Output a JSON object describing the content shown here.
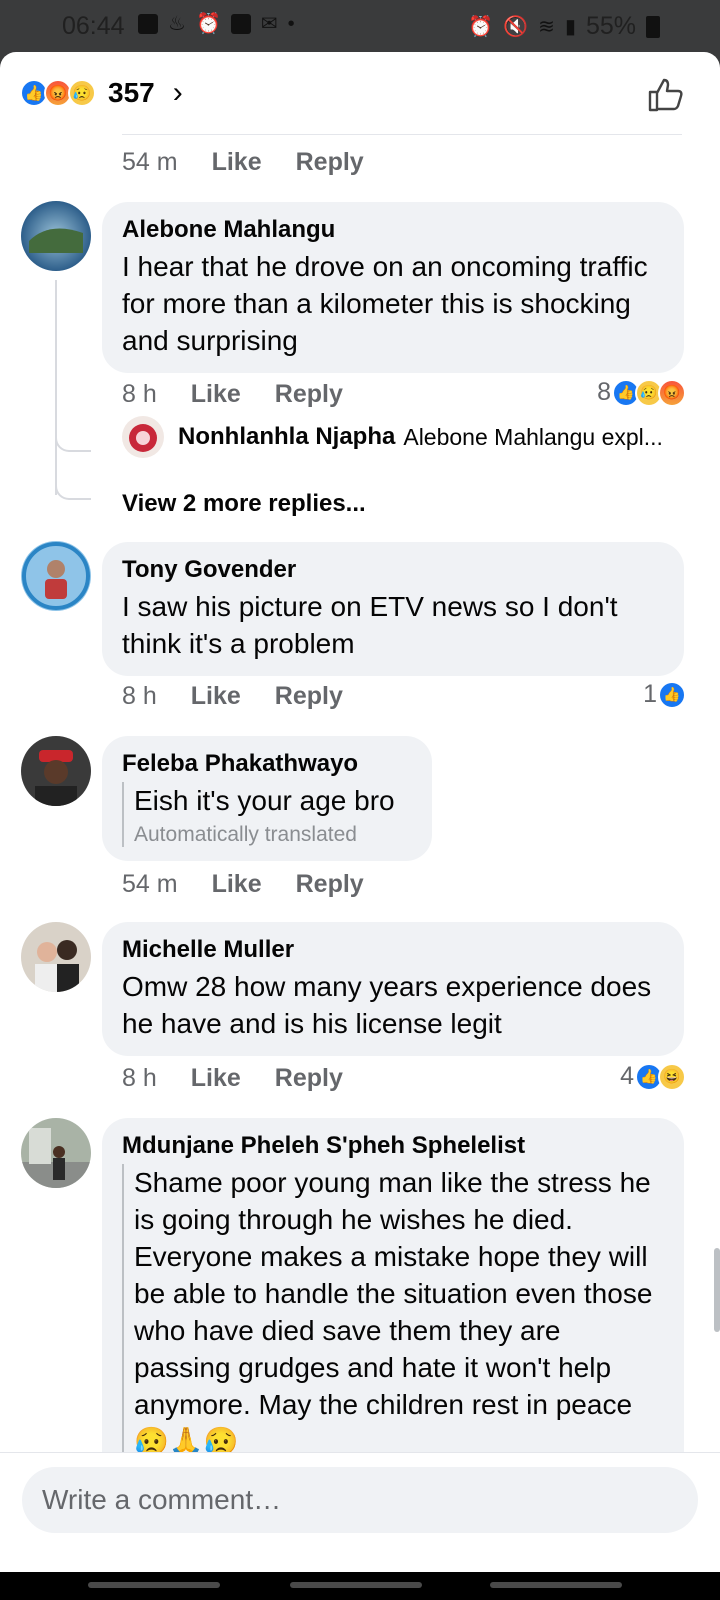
{
  "status_bar": {
    "time": "06:44",
    "battery": "55%",
    "battery_badge": "7",
    "left_icons": [
      "v-icon",
      "fire-icon",
      "alarm-icon",
      "check-icon",
      "gmail-icon",
      "dot-icon"
    ],
    "right_icons": [
      "alarm-icon",
      "mute-icon",
      "wifi-icon",
      "signal-icon",
      "battery-icon"
    ]
  },
  "header": {
    "reaction_icons": [
      "like",
      "angry",
      "sad"
    ],
    "reaction_count": "357",
    "chevron": "›",
    "like_button_icon": "thumbs-up-outline-icon"
  },
  "comments": [
    {
      "id": "previous",
      "time": "54 m",
      "like_label": "Like",
      "reply_label": "Reply"
    },
    {
      "id": "alebone",
      "name": "Alebone Mahlangu",
      "text": "I hear that he drove on an oncoming traffic for more than a kilometer this is shocking and surprising",
      "time": "8 h",
      "like_label": "Like",
      "reply_label": "Reply",
      "reaction_count": "8",
      "reactions": [
        "like",
        "sad",
        "angry"
      ],
      "reply_preview": {
        "name": "Nonhlanhla Njapha",
        "snippet": "Alebone Mahlangu expl..."
      },
      "more_replies": "View 2 more replies..."
    },
    {
      "id": "tony",
      "name": "Tony Govender",
      "text": "I saw his picture on ETV news so I don't think it's a problem",
      "time": "8 h",
      "like_label": "Like",
      "reply_label": "Reply",
      "reaction_count": "1",
      "reactions": [
        "like"
      ]
    },
    {
      "id": "feleba",
      "name": "Feleba Phakathwayo",
      "text": "Eish it's your age bro",
      "translated": "Automatically translated",
      "time": "54 m",
      "like_label": "Like",
      "reply_label": "Reply"
    },
    {
      "id": "michelle",
      "name": "Michelle Muller",
      "text": "Omw 28 how many years experience does he have and is his license legit",
      "time": "8 h",
      "like_label": "Like",
      "reply_label": "Reply",
      "reaction_count": "4",
      "reactions": [
        "like",
        "haha"
      ]
    },
    {
      "id": "mdunjane",
      "name": "Mdunjane Pheleh S'pheh Sphelelist",
      "text": "Shame poor young man like the stress he is going through he wishes he died. Everyone makes a mistake hope they will be able to handle the situation even those who have died save them they are passing grudges and hate it won't help anymore. May the children rest in peace",
      "emojis": "😥🙏😥"
    }
  ],
  "composer": {
    "placeholder": "Write a comment…"
  },
  "colors": {
    "bubble": "#f0f2f5",
    "meta_text": "#65676b",
    "like_blue": "#1877f2",
    "status_bar_bg": "#3a3b3c"
  }
}
